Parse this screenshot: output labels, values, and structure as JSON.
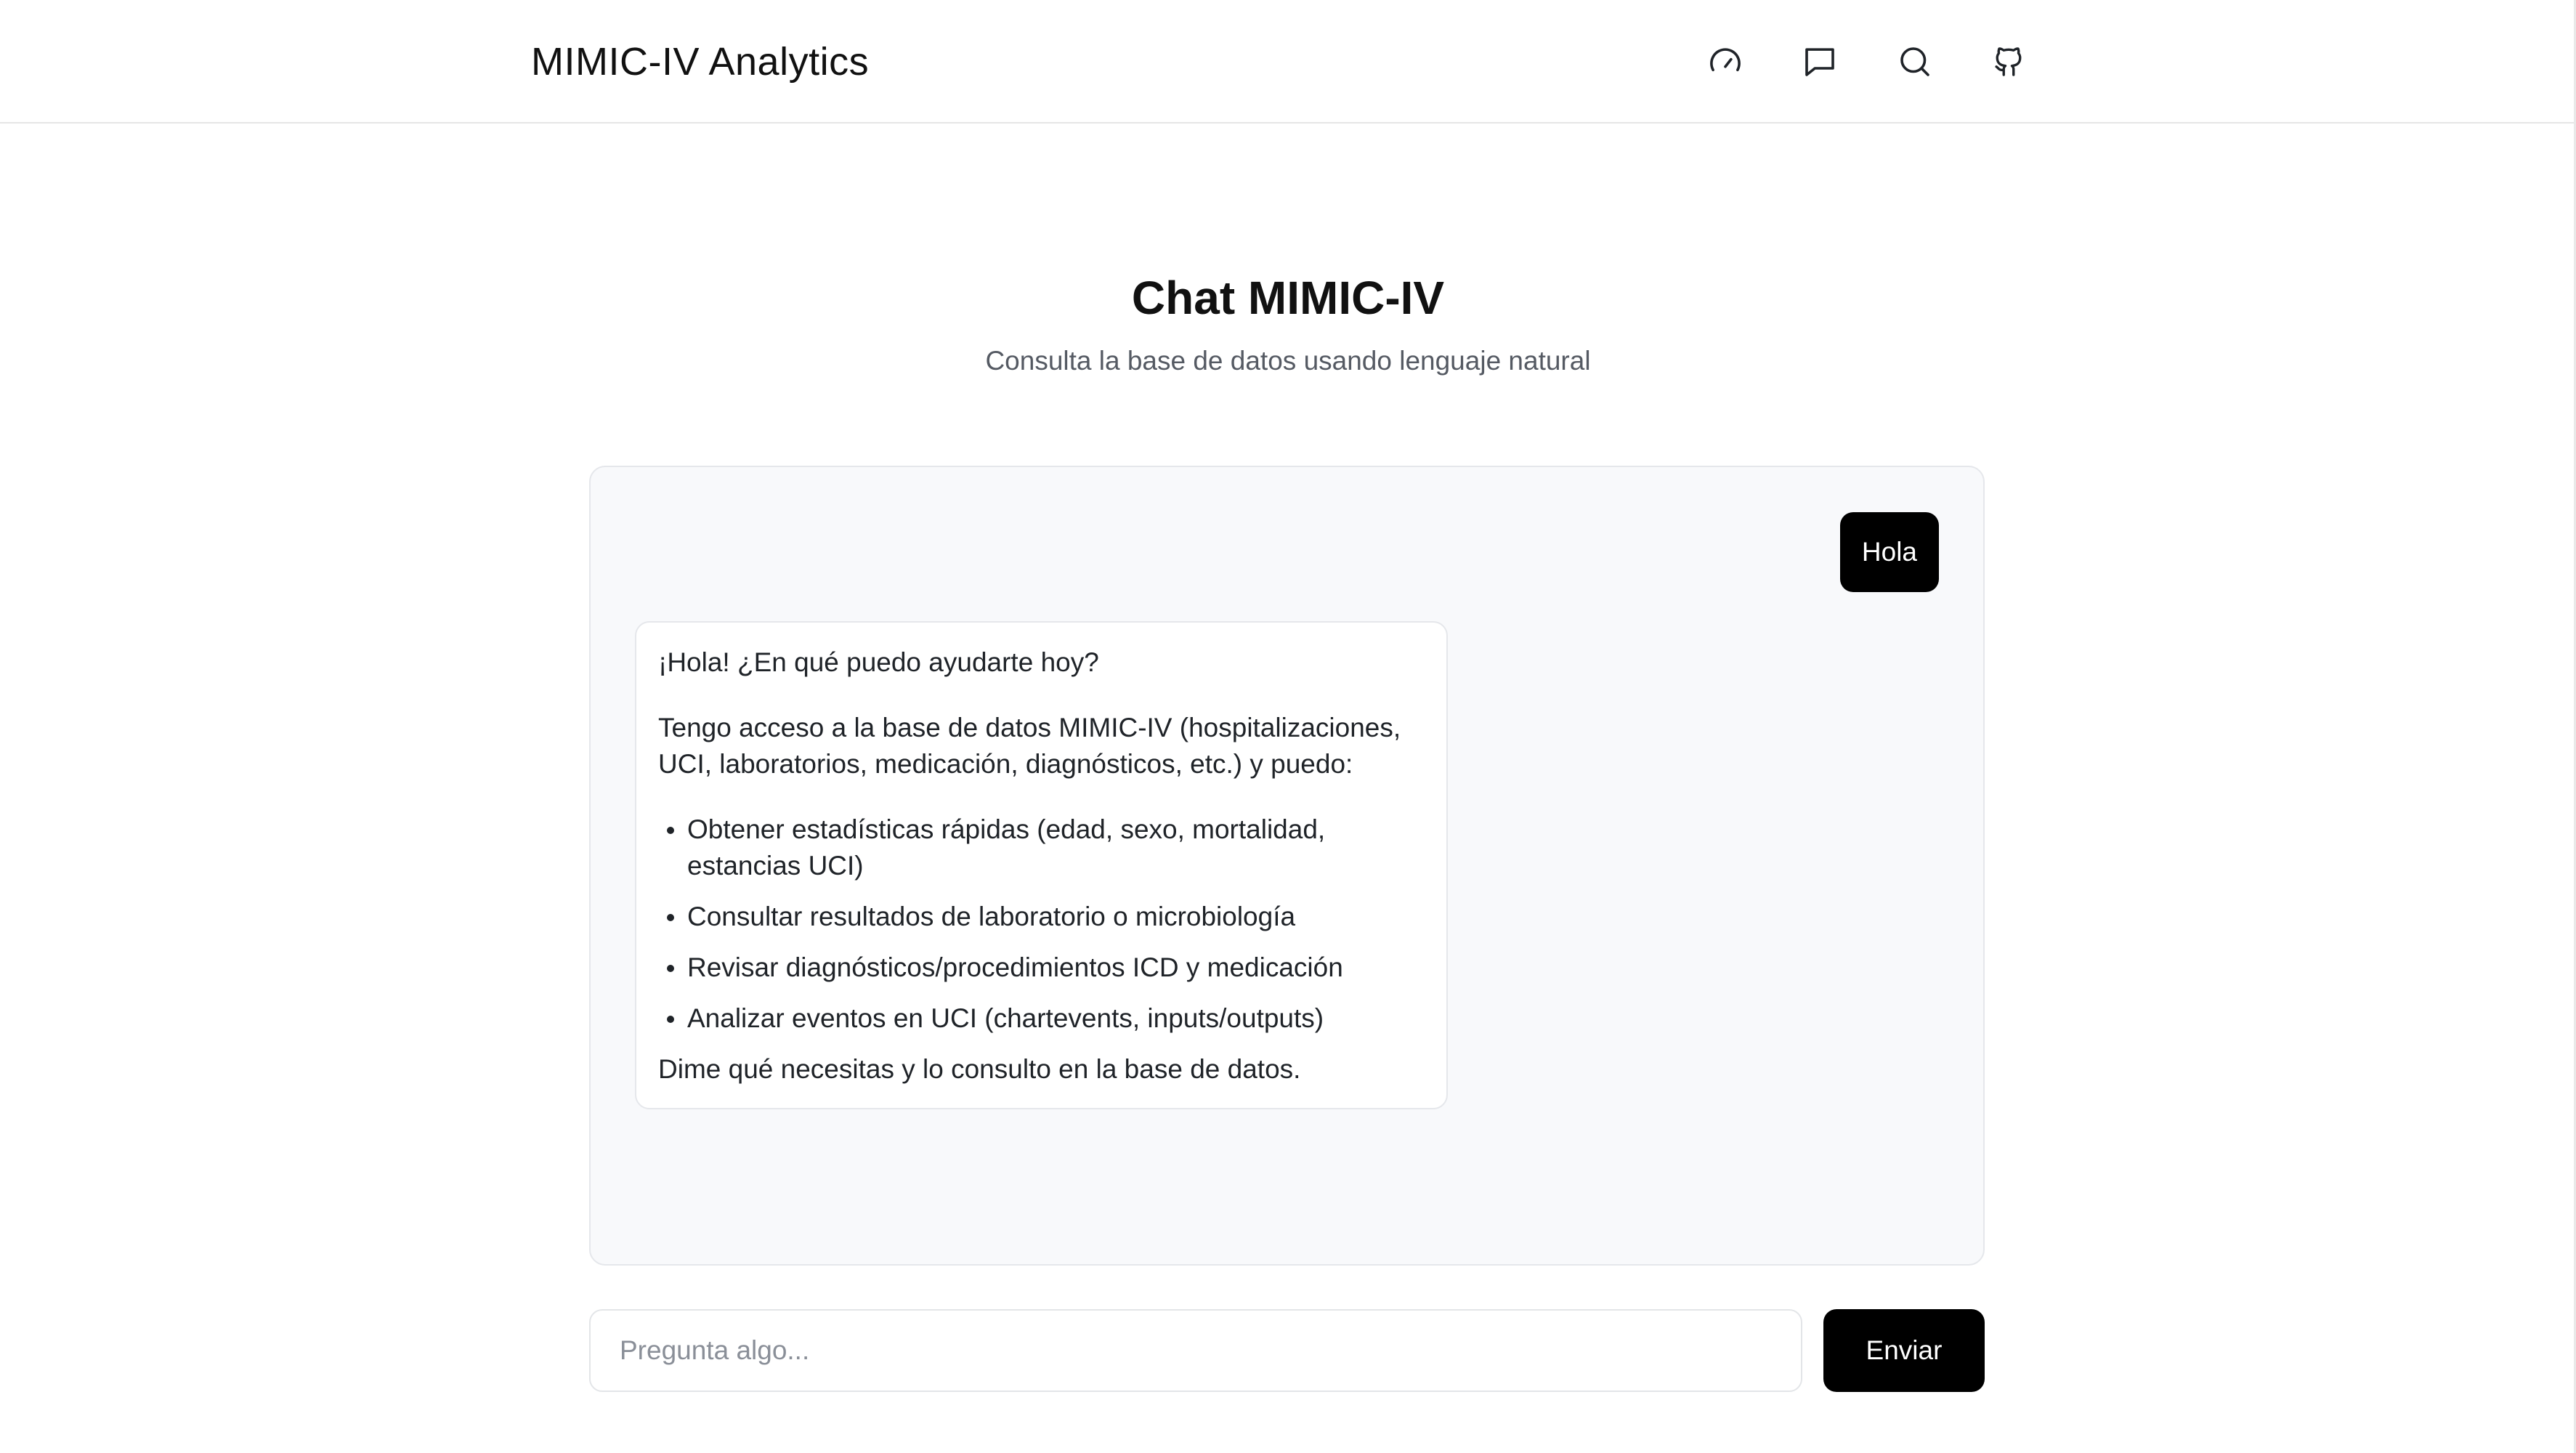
{
  "header": {
    "brand": "MIMIC-IV Analytics",
    "nav_icons": [
      "gauge-icon",
      "message-icon",
      "search-icon",
      "github-icon"
    ]
  },
  "hero": {
    "title": "Chat MIMIC-IV",
    "subtitle": "Consulta la base de datos usando lenguaje natural"
  },
  "chat": {
    "messages": [
      {
        "role": "user",
        "text": "Hola"
      },
      {
        "role": "assistant",
        "greeting": "¡Hola! ¿En qué puedo ayudarte hoy?",
        "intro": "Tengo acceso a la base de datos MIMIC-IV (hospitalizaciones, UCI, laboratorios, medicación, diagnósticos, etc.) y puedo:",
        "items": [
          "Obtener estadísticas rápidas (edad, sexo, mortalidad, estancias UCI)",
          "Consultar resultados de laboratorio o microbiología",
          "Revisar diagnósticos/procedimientos ICD y medicación",
          "Analizar eventos en UCI (chartevents, inputs/outputs)"
        ],
        "closing": "Dime qué necesitas y lo consulto en la base de datos."
      }
    ]
  },
  "composer": {
    "value": "",
    "placeholder": "Pregunta algo...",
    "send_label": "Enviar"
  },
  "colors": {
    "accent": "#000000",
    "panel_bg": "#f8f9fb",
    "border": "#e5e7eb",
    "muted_text": "#555a63"
  }
}
